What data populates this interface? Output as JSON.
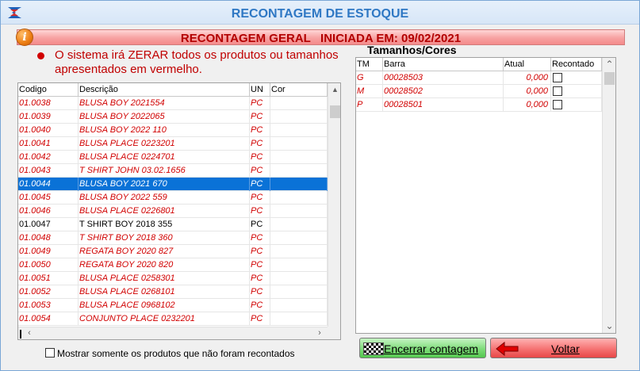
{
  "window": {
    "title": "RECONTAGEM DE ESTOQUE",
    "icon": "app-logo-icon"
  },
  "banner": {
    "icon": "info-icon",
    "icon_glyph": "i",
    "text": "RECONTAGEM GERAL   INICIADA EM: 09/02/2021"
  },
  "warning": {
    "text": "O sistema irá ZERAR todos os produtos ou tamanhos apresentados em vermelho."
  },
  "products": {
    "columns": [
      "Codigo",
      "Descrição",
      "UN",
      "Cor"
    ],
    "selected_index": 6,
    "rows": [
      {
        "codigo": "01.0038",
        "descricao": "BLUSA BOY 2021554",
        "un": "PC",
        "cor": "",
        "red": true
      },
      {
        "codigo": "01.0039",
        "descricao": "BLUSA BOY 2022065",
        "un": "PC",
        "cor": "",
        "red": true
      },
      {
        "codigo": "01.0040",
        "descricao": "BLUSA BOY 2022 110",
        "un": "PC",
        "cor": "",
        "red": true
      },
      {
        "codigo": "01.0041",
        "descricao": "BLUSA PLACE 0223201",
        "un": "PC",
        "cor": "",
        "red": true
      },
      {
        "codigo": "01.0042",
        "descricao": "BLUSA PLACE 0224701",
        "un": "PC",
        "cor": "",
        "red": true
      },
      {
        "codigo": "01.0043",
        "descricao": "T SHIRT JOHN 03.02.1656",
        "un": "PC",
        "cor": "",
        "red": true
      },
      {
        "codigo": "01.0044",
        "descricao": "BLUSA BOY 2021 670",
        "un": "PC",
        "cor": "",
        "red": true
      },
      {
        "codigo": "01.0045",
        "descricao": "BLUSA BOY 2022 559",
        "un": "PC",
        "cor": "",
        "red": true
      },
      {
        "codigo": "01.0046",
        "descricao": "BLUSA PLACE 0226801",
        "un": "PC",
        "cor": "",
        "red": true
      },
      {
        "codigo": "01.0047",
        "descricao": "T SHIRT BOY 2018 355",
        "un": "PC",
        "cor": "",
        "red": false
      },
      {
        "codigo": "01.0048",
        "descricao": "T SHIRT BOY 2018 360",
        "un": "PC",
        "cor": "",
        "red": true
      },
      {
        "codigo": "01.0049",
        "descricao": "REGATA BOY 2020 827",
        "un": "PC",
        "cor": "",
        "red": true
      },
      {
        "codigo": "01.0050",
        "descricao": "REGATA BOY 2020 820",
        "un": "PC",
        "cor": "",
        "red": true
      },
      {
        "codigo": "01.0051",
        "descricao": "BLUSA PLACE 0258301",
        "un": "PC",
        "cor": "",
        "red": true
      },
      {
        "codigo": "01.0052",
        "descricao": "BLUSA PLACE 0268101",
        "un": "PC",
        "cor": "",
        "red": true
      },
      {
        "codigo": "01.0053",
        "descricao": "BLUSA PLACE 0968102",
        "un": "PC",
        "cor": "",
        "red": true
      },
      {
        "codigo": "01.0054",
        "descricao": "CONJUNTO PLACE 0232201",
        "un": "PC",
        "cor": "",
        "red": true
      }
    ],
    "scroll_left_glyph": "‹",
    "scroll_right_glyph": "›",
    "scroll_up_glyph": "▲"
  },
  "sizes": {
    "title": "Tamanhos/Cores",
    "columns": [
      "TM",
      "Barra",
      "Atual",
      "Recontado"
    ],
    "rows": [
      {
        "tm": "G",
        "barra": "00028503",
        "atual": "0,000",
        "recontado": false
      },
      {
        "tm": "M",
        "barra": "00028502",
        "atual": "0,000",
        "recontado": false
      },
      {
        "tm": "P",
        "barra": "00028501",
        "atual": "0,000",
        "recontado": false
      }
    ],
    "scroll_up_glyph": "⌃",
    "scroll_down_glyph": "⌄"
  },
  "filter": {
    "label": "Mostrar somente os produtos que não foram recontados",
    "checked": false
  },
  "buttons": {
    "finish_label": "Encerrar contagem",
    "finish_icon": "checkered-flag-icon",
    "back_label": "Voltar",
    "back_icon": "arrow-left-icon"
  },
  "colors": {
    "title": "#2f78c4",
    "banner_text": "#b30000",
    "warning_text": "#c00000",
    "uncounted_row": "#d10000",
    "selected_row": "#0a72d7"
  }
}
